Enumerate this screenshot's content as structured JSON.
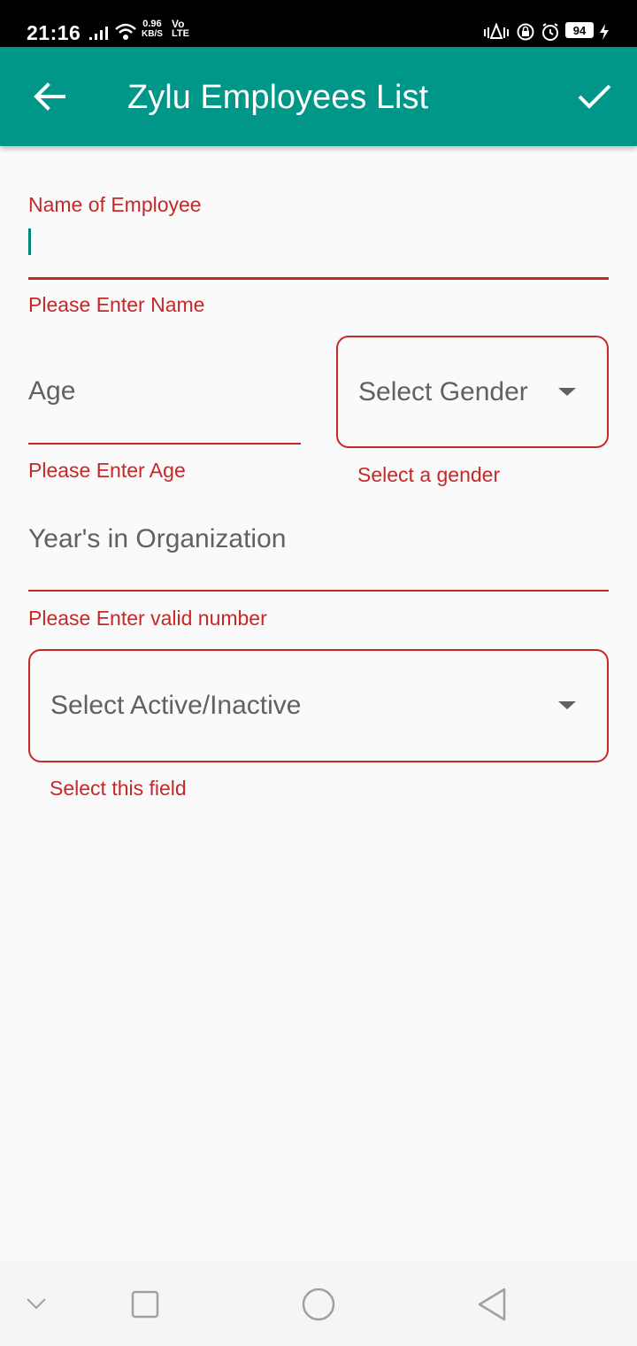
{
  "status_bar": {
    "time": "21:16",
    "net_speed_value": "0.96",
    "net_speed_unit": "KB/S",
    "volte_top": "Vo",
    "volte_bottom": "LTE",
    "battery": "94"
  },
  "app_bar": {
    "title": "Zylu Employees List",
    "back_icon": "arrow-back-icon",
    "confirm_icon": "check-icon"
  },
  "form": {
    "name": {
      "label": "Name of Employee",
      "value": "",
      "error": "Please Enter Name"
    },
    "age": {
      "placeholder": "Age",
      "error": "Please Enter Age"
    },
    "gender": {
      "placeholder": "Select Gender",
      "error": "Select a gender"
    },
    "years": {
      "placeholder": "Year's in Organization",
      "error": "Please Enter valid number"
    },
    "status": {
      "placeholder": "Select Active/Inactive",
      "error": "Select this field"
    }
  },
  "colors": {
    "primary": "#009688",
    "error": "#c62828",
    "hint": "#616161",
    "background": "#fafafa"
  },
  "nav_bar": {
    "icons": [
      "chevron-down-icon",
      "recents-square-icon",
      "home-circle-icon",
      "back-triangle-icon"
    ]
  }
}
